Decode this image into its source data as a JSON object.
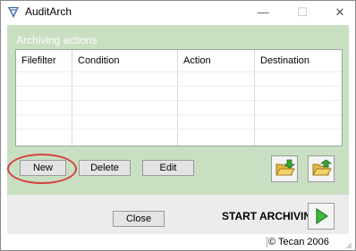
{
  "window": {
    "title": "AuditArch",
    "minimize_glyph": "—",
    "maximize_glyph": "☐",
    "close_glyph": "✕"
  },
  "panel": {
    "label": "Archiving actions",
    "columns": [
      "Filefilter",
      "Condition",
      "Action",
      "Destination"
    ],
    "rows": []
  },
  "buttons": {
    "new": "New",
    "delete": "Delete",
    "edit": "Edit",
    "close": "Close"
  },
  "icons": {
    "load": "folder-open-icon",
    "save": "folder-save-icon",
    "start": "play-icon",
    "app": "app-icon"
  },
  "start_label": "START ARCHIVING",
  "status": {
    "copyright": "© Tecan 2006"
  },
  "colors": {
    "panel_bg": "#c8dfc1",
    "highlight": "#d64040",
    "play": "#2f9a2f"
  }
}
